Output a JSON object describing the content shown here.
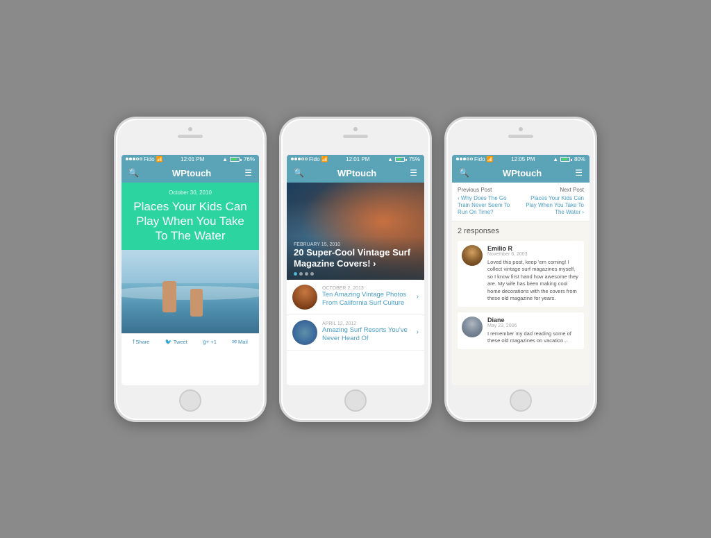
{
  "phones": [
    {
      "id": "phone1",
      "status": {
        "carrier": "Fido",
        "time": "12:01 PM",
        "battery_pct": "76%"
      },
      "navbar": {
        "title": "WPtouch"
      },
      "article": {
        "date": "October 30, 2010",
        "title": "Places Your Kids Can Play When You Take To The Water"
      },
      "share": {
        "facebook": "Share",
        "twitter": "Tweet",
        "google": "+1",
        "mail": "Mail"
      }
    },
    {
      "id": "phone2",
      "status": {
        "carrier": "Fido",
        "time": "12:01 PM",
        "battery_pct": "75%"
      },
      "navbar": {
        "title": "WPtouch"
      },
      "hero": {
        "date": "February 15, 2010",
        "title": "20 Super-Cool Vintage Surf Magazine Covers! ›"
      },
      "list_items": [
        {
          "date": "October 2, 2013",
          "title": "Ten Amazing Vintage Photos From California Surf Culture"
        },
        {
          "date": "April 12, 2012",
          "title": "Amazing Surf Resorts You've Never Heard Of"
        }
      ]
    },
    {
      "id": "phone3",
      "status": {
        "carrier": "Fido",
        "time": "12:05 PM",
        "battery_pct": "80%"
      },
      "navbar": {
        "title": "WPtouch"
      },
      "prev_post": {
        "label": "Previous Post",
        "title": "‹ Why Does The Go Train Never Seem To Run On Time?"
      },
      "next_post": {
        "label": "Next Post",
        "title": "Places Your Kids Can Play When You Take To The Water ›"
      },
      "responses": {
        "count": "2 responses",
        "comments": [
          {
            "name": "Emilio R",
            "date": "November 6, 2003",
            "text": "Loved this post, keep 'em coming! I collect vintage surf magazines myself, so I know first hand how awesome they are. My wife has been making cool home decorations with the covers from these old magazine for years."
          },
          {
            "name": "Diane",
            "date": "May 23, 2006",
            "text": "I remember my dad reading some of these old magazines on vacation..."
          }
        ]
      }
    }
  ]
}
